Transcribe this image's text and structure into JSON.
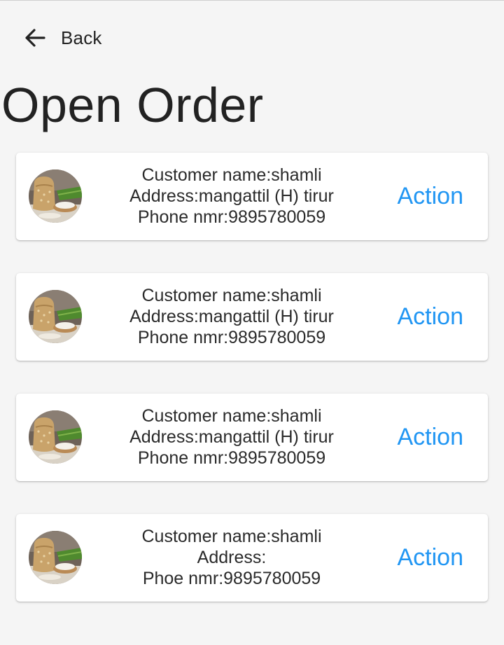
{
  "header": {
    "back_label": "Back",
    "title": "Open Order"
  },
  "orders": [
    {
      "customer": "Customer name:shamli",
      "address": "Address:mangattil (H) tirur",
      "phone": "Phone nmr:9895780059",
      "action": "Action",
      "image_icon": "rice-sack-icon"
    },
    {
      "customer": "Customer name:shamli",
      "address": "Address:mangattil (H) tirur",
      "phone": "Phone nmr:9895780059",
      "action": "Action",
      "image_icon": "rice-sack-icon"
    },
    {
      "customer": "Customer name:shamli",
      "address": "Address:mangattil (H) tirur",
      "phone": "Phone nmr:9895780059",
      "action": "Action",
      "image_icon": "rice-sack-icon"
    },
    {
      "customer": "Customer name:shamli",
      "address": "Address:",
      "phone": "Phoe nmr:9895780059",
      "action": "Action",
      "image_icon": "rice-sack-icon"
    }
  ],
  "colors": {
    "accent": "#2196f3",
    "background": "#f5f5f5",
    "card": "#ffffff",
    "text": "#222222"
  }
}
